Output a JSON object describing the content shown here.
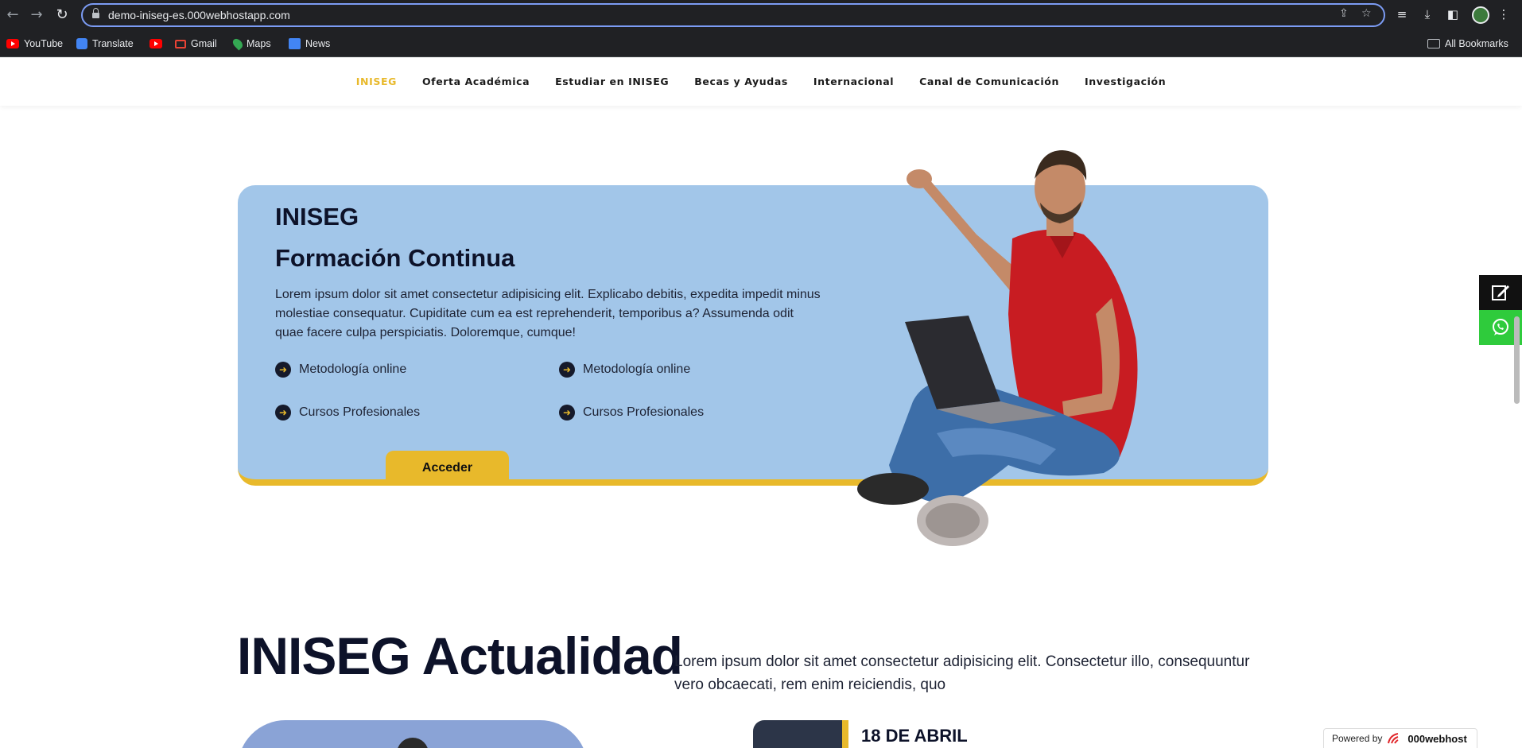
{
  "browser": {
    "url": "demo-iniseg-es.000webhostapp.com",
    "bookmarks": [
      "YouTube",
      "Translate",
      "",
      "Gmail",
      "Maps",
      "News"
    ],
    "all_bookmarks_label": "All Bookmarks"
  },
  "nav": {
    "items": [
      "INISEG",
      "Oferta Académica",
      "Estudiar en INISEG",
      "Becas y Ayudas",
      "Internacional",
      "Canal de Comunicación",
      "Investigación"
    ],
    "active_index": 0
  },
  "hero": {
    "brand": "INISEG",
    "title": "Formación Continua",
    "description": "Lorem ipsum dolor sit amet consectetur adipisicing elit. Explicabo debitis, expedita impedit minus molestiae consequatur. Cupiditate cum ea est reprehenderit, temporibus a? Assumenda odit quae facere culpa perspiciatis. Doloremque, cumque!",
    "features": [
      "Metodología online",
      "Metodología online",
      "Cursos Profesionales",
      "Cursos Profesionales"
    ],
    "button_label": "Acceder"
  },
  "news": {
    "heading": "INISEG Actualidad",
    "description": "Lorem ipsum dolor sit amet consectetur adipisicing elit. Consectetur illo, consequuntur vero obcaecati, rem enim reiciendis, quo",
    "first_date": "18 DE ABRIL"
  },
  "footer_badge": {
    "powered_label": "Powered by",
    "host_name": "000webhost"
  },
  "colors": {
    "accent": "#e8b92b",
    "hero_bg": "#a2c6e9",
    "dark": "#0d1229",
    "whatsapp": "#2fcb3c"
  }
}
